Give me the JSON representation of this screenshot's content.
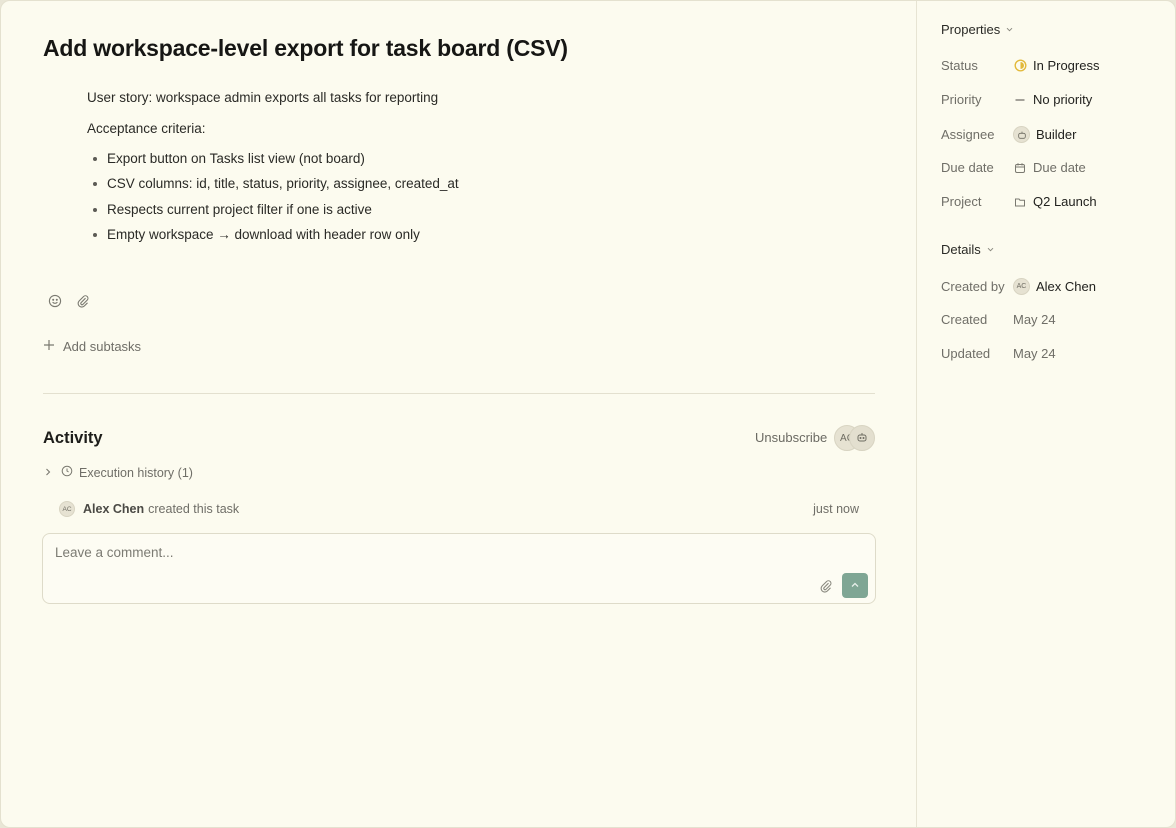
{
  "task": {
    "title": "Add workspace-level export for task board (CSV)",
    "description": {
      "story": "User story: workspace admin exports all tasks for reporting",
      "criteria_heading": "Acceptance criteria:",
      "criteria": [
        "Export button on Tasks list view (not board)",
        "CSV columns: id, title, status, priority, assignee, created_at",
        "Respects current project filter if one is active",
        "Empty workspace → download with header row only"
      ]
    },
    "toolbar_icons": [
      "emoji-icon",
      "attachment-icon"
    ],
    "add_subtasks_label": "Add subtasks"
  },
  "activity": {
    "title": "Activity",
    "unsubscribe_label": "Unsubscribe",
    "subscriber_initials": "AC",
    "execution_history_label": "Execution history (1)",
    "events": [
      {
        "avatar_initials": "AC",
        "actor": "Alex Chen",
        "action": "created this task",
        "time": "just now"
      }
    ],
    "comment_placeholder": "Leave a comment..."
  },
  "sidebar": {
    "properties_heading": "Properties",
    "properties": {
      "status": {
        "label": "Status",
        "value": "In Progress"
      },
      "priority": {
        "label": "Priority",
        "value": "No priority"
      },
      "assignee": {
        "label": "Assignee",
        "value": "Builder"
      },
      "due_date": {
        "label": "Due date",
        "value": "Due date"
      },
      "project": {
        "label": "Project",
        "value": "Q2 Launch"
      }
    },
    "details_heading": "Details",
    "details": {
      "created_by": {
        "label": "Created by",
        "value": "Alex Chen",
        "initials": "AC"
      },
      "created": {
        "label": "Created",
        "value": "May 24"
      },
      "updated": {
        "label": "Updated",
        "value": "May 24"
      }
    }
  },
  "colors": {
    "background": "#fcfbef",
    "accent_send": "#7fa694",
    "status_in_progress": "#e2b93b"
  }
}
